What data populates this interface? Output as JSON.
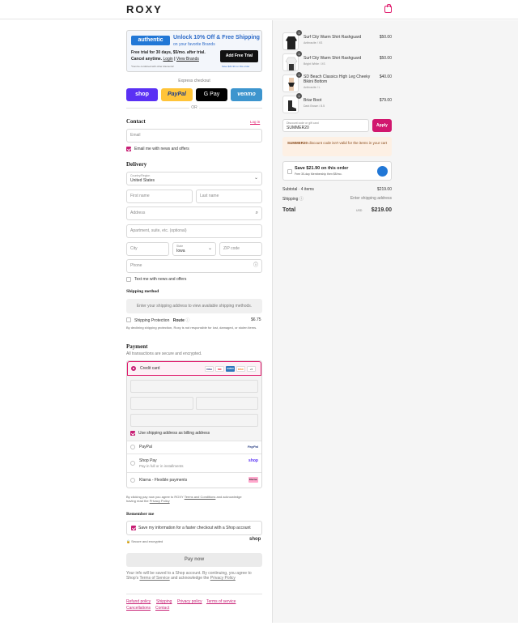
{
  "brand": {
    "logo_text": "ROXY",
    "accent": "#c71e74"
  },
  "promo": {
    "logo_text": "authentic",
    "title": "Unlock 10% Off & Free Shipping",
    "subtitle": "on your favorite Brands",
    "line1": "Free trial for 30 days, $5/mo. after trial.",
    "line2_prefix": "Cancel anytime.",
    "login": "Login",
    "divider": "|",
    "view_brands": "View Brands",
    "fine_print": "*Can be combined with other discounts!",
    "button": "Add Free Trial",
    "button_note": "Save $21.90 on this order"
  },
  "express": {
    "label": "Express checkout",
    "buttons": [
      "shop",
      "PayPal",
      "G Pay",
      "venmo"
    ],
    "or": "OR"
  },
  "contact": {
    "title": "Contact",
    "login_link": "Log in",
    "email_placeholder": "Email",
    "news_label": "Email me with news and offers"
  },
  "delivery": {
    "title": "Delivery",
    "country_label": "Country/Region",
    "country_value": "United States",
    "first_name": "First name",
    "last_name": "Last name",
    "address": "Address",
    "apartment": "Apartment, suite, etc. (optional)",
    "city": "City",
    "state_label": "State",
    "state_value": "Iowa",
    "zip": "ZIP code",
    "phone": "Phone",
    "text_label": "Text me with news and offers"
  },
  "shipping_method": {
    "title": "Shipping method",
    "message": "Enter your shipping address to view available shipping methods.",
    "protection_label": "Shipping Protection",
    "protection_brand": "Route",
    "protection_price": "$6.75",
    "protection_note": "By declining shipping protection, Roxy is not responsible for lost, damaged, or stolen items."
  },
  "payment": {
    "title": "Payment",
    "subtitle": "All transactions are secure and encrypted.",
    "credit_card": "Credit card",
    "card_logos": [
      "VISA",
      "MC",
      "AMEX",
      "DISC",
      "+5"
    ],
    "billing_label": "Use shipping address as billing address",
    "paypal": "PayPal",
    "paypal_logo": "PayPal",
    "shop_pay": "Shop Pay",
    "shop_pay_sub": "Pay in full or in installments",
    "shop_logo": "shop",
    "klarna": "Klarna - Flexible payments",
    "klarna_logo": "Klarna."
  },
  "legal": {
    "line1_prefix": "By clicking pay now you agree to ROXY",
    "terms_link": "Terms and Conditions",
    "line1_suffix": "and acknowledge",
    "line2_prefix": "having read the",
    "privacy_link": "Privacy Policy"
  },
  "remember": {
    "title": "Remember me",
    "save_label": "Save my information for a faster checkout with a Shop account",
    "secure": "Secure and encrypted",
    "shop_logo": "shop"
  },
  "pay_now": "Pay now",
  "shop_notice": {
    "line1": "Your info will be saved to a Shop account. By continuing, you agree to",
    "line2_prefix": "Shop's",
    "tos": "Terms of Service",
    "line2_mid": "and acknowledge the",
    "privacy": "Privacy Policy"
  },
  "footer_links": [
    "Refund policy",
    "Shipping",
    "Privacy policy",
    "Terms of service",
    "Cancellations",
    "Contact"
  ],
  "cart": {
    "items": [
      {
        "qty": "1",
        "name": "Surf City Warm Shirt Rashguard",
        "variant": "Anthracite / XS",
        "price": "$50.00"
      },
      {
        "qty": "1",
        "name": "Surf City Warm Shirt Rashguard",
        "variant": "Bright White / XS",
        "price": "$50.00"
      },
      {
        "qty": "1",
        "name": "SD Beach Classics High Leg Cheeky Bikini Bottom",
        "variant": "Anthracite / L",
        "price": "$40.00"
      },
      {
        "qty": "1",
        "name": "Briar Boot",
        "variant": "Dark Brown / 8.5",
        "price": "$79.00"
      }
    ],
    "discount_label": "Discount code or gift card",
    "discount_value": "SUMMER20",
    "apply": "Apply",
    "error_code": "SUMMER20",
    "error_text": "discount code isn't valid for the items in your cart",
    "save_title": "Save $21.90 on this order",
    "save_sub": "Free 30-day Membership then $5/mo.",
    "subtotal_label": "Subtotal · 4 items",
    "subtotal_value": "$219.00",
    "shipping_label": "Shipping",
    "shipping_value": "Enter shipping address",
    "total_label": "Total",
    "currency": "USD",
    "total_value": "$219.00"
  }
}
